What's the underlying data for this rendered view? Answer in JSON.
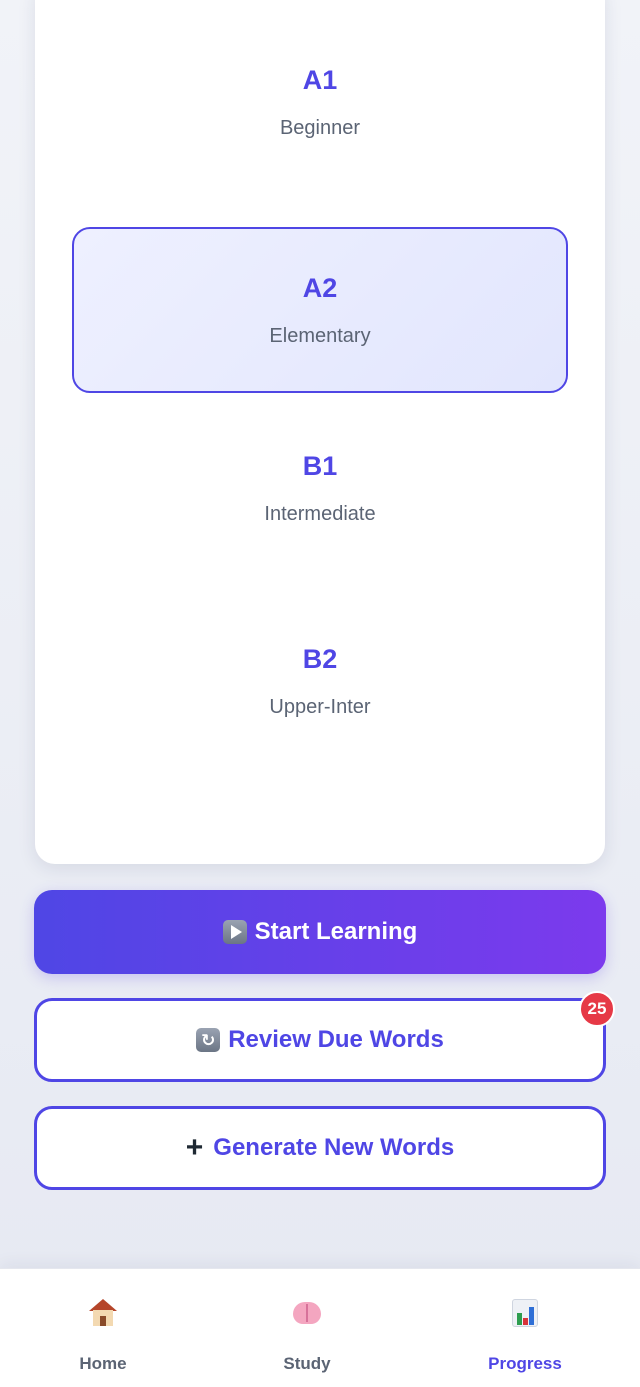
{
  "levels": [
    {
      "code": "A1",
      "description": "Beginner",
      "selected": false
    },
    {
      "code": "A2",
      "description": "Elementary",
      "selected": true
    },
    {
      "code": "B1",
      "description": "Intermediate",
      "selected": false
    },
    {
      "code": "B2",
      "description": "Upper-Inter",
      "selected": false
    }
  ],
  "actions": {
    "start_label": "Start Learning",
    "start_icon": "play-icon",
    "review_label": "Review Due Words",
    "review_icon": "refresh-icon",
    "review_badge": "25",
    "generate_label": "Generate New Words",
    "generate_icon": "plus-icon"
  },
  "nav": {
    "items": [
      {
        "label": "Home",
        "icon": "house-icon",
        "active": false
      },
      {
        "label": "Study",
        "icon": "brain-icon",
        "active": false
      },
      {
        "label": "Progress",
        "icon": "bar-chart-icon",
        "active": true
      }
    ]
  },
  "colors": {
    "accent": "#4f46e5",
    "accent_end": "#7c3aed",
    "badge": "#e63946",
    "selected_bg": "#e6e9fd"
  }
}
